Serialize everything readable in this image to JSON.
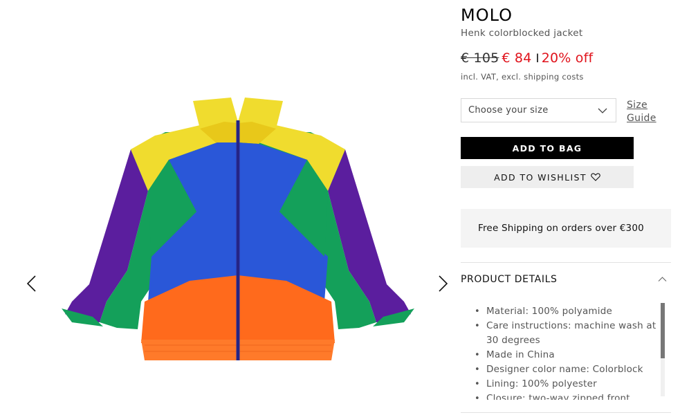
{
  "product": {
    "brand": "MOLO",
    "name": "Henk colorblocked jacket",
    "price_old": "€ 105",
    "price_new": "€ 84",
    "price_separator": "I",
    "discount": "20% off",
    "vat_note": "incl. VAT, excl. shipping costs"
  },
  "size": {
    "placeholder": "Choose your size",
    "guide_label": "Size Guide"
  },
  "actions": {
    "add_to_bag": "ADD TO BAG",
    "add_to_wishlist": "ADD TO WISHLIST"
  },
  "shipping": {
    "text": "Free Shipping on orders over €300"
  },
  "details": {
    "title": "PRODUCT DETAILS",
    "items": [
      "Material: 100% polyamide",
      "Care instructions: machine wash at 30 degrees",
      "Made in China",
      "Designer color name: Colorblock",
      "Lining: 100% polyester",
      "Closure: two-way zipped front"
    ]
  },
  "icons": {
    "prev": "chevron-left-icon",
    "next": "chevron-right-icon",
    "dropdown": "chevron-down-icon",
    "wishlist": "heart-icon",
    "collapse": "chevron-up-icon"
  },
  "colors": {
    "sale_red": "#e0121b",
    "button_black": "#000000",
    "jacket_yellow": "#f0dc2e",
    "jacket_blue": "#2a57d8",
    "jacket_green": "#14a05a",
    "jacket_purple": "#5b1e9e",
    "jacket_orange": "#ff6a1c"
  }
}
